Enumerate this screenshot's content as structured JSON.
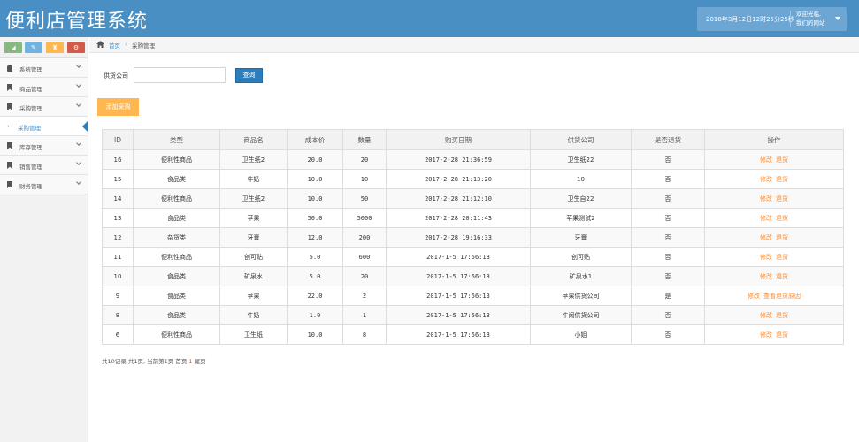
{
  "header": {
    "app_title": "便利店管理系统",
    "datetime": "2018年3月12日12时25分25秒",
    "welcome_line1": "欢迎光临,",
    "welcome_line2": "我们的网站"
  },
  "sidebar": {
    "shortcut_colors": [
      "#87b87f",
      "#6fb3e0",
      "#ffb752",
      "#d15b47"
    ],
    "items": [
      {
        "label": "系统管理",
        "icon": "user-icon"
      },
      {
        "label": "商品管理",
        "icon": "bookmark-icon"
      },
      {
        "label": "采购管理",
        "icon": "bookmark-icon"
      },
      {
        "label": "库存管理",
        "icon": "bookmark-icon"
      },
      {
        "label": "销售管理",
        "icon": "bookmark-icon"
      },
      {
        "label": "财务管理",
        "icon": "bookmark-icon"
      }
    ],
    "active_sub": {
      "label": "采购管理"
    }
  },
  "breadcrumb": {
    "home": "首页",
    "current": "采购管理"
  },
  "search": {
    "label": "供货公司",
    "value": "",
    "button": "查询"
  },
  "add_button": "添加采购",
  "table": {
    "headers": [
      "ID",
      "类型",
      "商品名",
      "成本价",
      "数量",
      "购买日期",
      "供货公司",
      "是否退货",
      "操作"
    ],
    "rows": [
      {
        "id": "16",
        "type": "便利性商品",
        "name": "卫生纸2",
        "cost": "20.0",
        "qty": "20",
        "date": "2017-2-28 21:36:59",
        "supplier": "卫生纸22",
        "returned": "否",
        "actions": [
          "修改",
          "退货"
        ]
      },
      {
        "id": "15",
        "type": "食品类",
        "name": "牛奶",
        "cost": "10.0",
        "qty": "10",
        "date": "2017-2-28 21:13:20",
        "supplier": "10",
        "returned": "否",
        "actions": [
          "修改",
          "退货"
        ]
      },
      {
        "id": "14",
        "type": "便利性商品",
        "name": "卫生纸2",
        "cost": "10.0",
        "qty": "50",
        "date": "2017-2-28 21:12:10",
        "supplier": "卫生自22",
        "returned": "否",
        "actions": [
          "修改",
          "退货"
        ]
      },
      {
        "id": "13",
        "type": "食品类",
        "name": "苹果",
        "cost": "50.0",
        "qty": "5000",
        "date": "2017-2-28 20:11:43",
        "supplier": "苹果测试2",
        "returned": "否",
        "actions": [
          "修改",
          "退货"
        ]
      },
      {
        "id": "12",
        "type": "杂货类",
        "name": "牙膏",
        "cost": "12.0",
        "qty": "200",
        "date": "2017-2-28 19:16:33",
        "supplier": "牙膏",
        "returned": "否",
        "actions": [
          "修改",
          "退货"
        ]
      },
      {
        "id": "11",
        "type": "便利性商品",
        "name": "创可贴",
        "cost": "5.0",
        "qty": "600",
        "date": "2017-1-5 17:56:13",
        "supplier": "创可贴",
        "returned": "否",
        "actions": [
          "修改",
          "退货"
        ]
      },
      {
        "id": "10",
        "type": "食品类",
        "name": "矿泉水",
        "cost": "5.0",
        "qty": "20",
        "date": "2017-1-5 17:56:13",
        "supplier": "矿泉水1",
        "returned": "否",
        "actions": [
          "修改",
          "退货"
        ]
      },
      {
        "id": "9",
        "type": "食品类",
        "name": "苹果",
        "cost": "22.0",
        "qty": "2",
        "date": "2017-1-5 17:56:13",
        "supplier": "苹果供货公司",
        "returned": "是",
        "actions": [
          "修改",
          "查看退货原因"
        ]
      },
      {
        "id": "8",
        "type": "食品类",
        "name": "牛奶",
        "cost": "1.0",
        "qty": "1",
        "date": "2017-1-5 17:56:13",
        "supplier": "牛闹供货公司",
        "returned": "否",
        "actions": [
          "修改",
          "退货"
        ]
      },
      {
        "id": "6",
        "type": "便利性商品",
        "name": "卫生纸",
        "cost": "10.0",
        "qty": "8",
        "date": "2017-1-5 17:56:13",
        "supplier": "小姐",
        "returned": "否",
        "actions": [
          "修改",
          "退货"
        ]
      }
    ]
  },
  "pagination": {
    "summary": "共10记录,共1页, 当前第1页",
    "first": "首页",
    "current": "1",
    "last": "尾页"
  }
}
